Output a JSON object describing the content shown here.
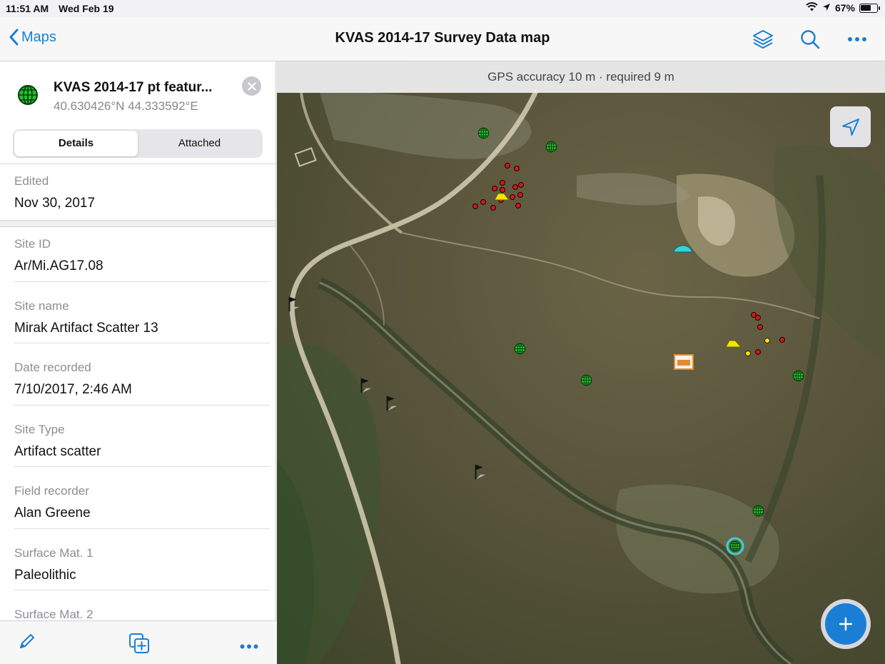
{
  "status_bar": {
    "time": "11:51 AM",
    "date": "Wed Feb 19",
    "battery_text": "67%",
    "battery_level": 0.67
  },
  "nav": {
    "back_label": "Maps",
    "title": "KVAS 2014-17 Survey Data map",
    "icons": [
      "layers-icon",
      "search-icon",
      "more-icon"
    ]
  },
  "feature": {
    "title": "KVAS 2014-17 pt featur...",
    "coords": "40.630426°N  44.333592°E"
  },
  "tabs": [
    {
      "label": "Details",
      "active": true
    },
    {
      "label": "Attached",
      "active": false
    }
  ],
  "edited": {
    "label": "Edited",
    "value": "Nov 30, 2017"
  },
  "fields": [
    {
      "label": "Site ID",
      "value": "Ar/Mi.AG17.08"
    },
    {
      "label": "Site name",
      "value": "Mirak Artifact Scatter 13"
    },
    {
      "label": "Date recorded",
      "value": "7/10/2017, 2:46 AM"
    },
    {
      "label": "Site Type",
      "value": "Artifact scatter"
    },
    {
      "label": "Field recorder",
      "value": "Alan Greene"
    },
    {
      "label": "Surface Mat. 1",
      "value": "Paleolithic"
    },
    {
      "label": "Surface Mat. 2",
      "value": ""
    }
  ],
  "map": {
    "gps_banner": "GPS accuracy 10 m · required 9 m"
  },
  "colors": {
    "accent": "#1a7fd4",
    "marker_green": "#22c02e",
    "marker_red": "#d01818",
    "marker_yellow": "#f2e600",
    "marker_cyan": "#36d2d8"
  }
}
